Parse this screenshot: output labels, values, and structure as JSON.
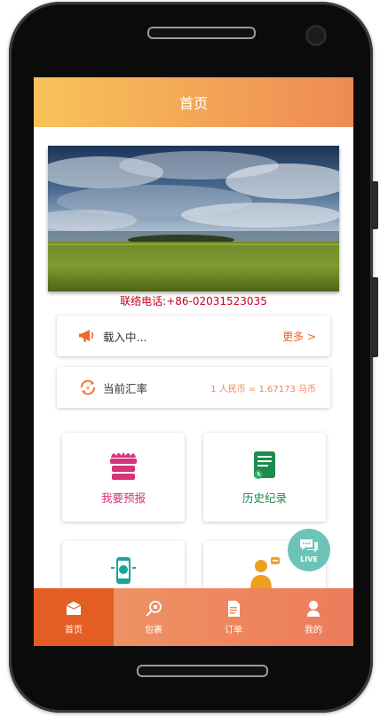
{
  "header": {
    "title": "首页"
  },
  "contact": {
    "text": "联络电话:+86-02031523035"
  },
  "notice": {
    "icon": "megaphone-icon",
    "text": "载入中...",
    "more": "更多 >"
  },
  "exchange": {
    "icon": "currency-exchange-icon",
    "label": "当前汇率",
    "value": "1 人民币 = 1.67173 马币"
  },
  "tiles": [
    {
      "label": "我要预报",
      "icon": "cake-box-icon",
      "color": "#d6337a"
    },
    {
      "label": "历史纪录",
      "icon": "history-scroll-icon",
      "color": "#1e8a4e"
    },
    {
      "label": "",
      "icon": "mobile-phone-icon",
      "color": "#1aa59b"
    },
    {
      "label": "",
      "icon": "customer-service-icon",
      "color": "#f0a020"
    }
  ],
  "live_chat": {
    "label": "LIVE",
    "icon": "chat-bubble-icon"
  },
  "tabbar": {
    "items": [
      {
        "label": "首页",
        "icon": "home-box-icon",
        "active": true
      },
      {
        "label": "包裹",
        "icon": "package-search-icon",
        "active": false
      },
      {
        "label": "订单",
        "icon": "order-document-icon",
        "active": false
      },
      {
        "label": "我的",
        "icon": "user-icon",
        "active": false
      }
    ]
  },
  "colors": {
    "accent": "#e45d23",
    "header_start": "#f8c35a",
    "header_end": "#ee8a55",
    "contact_red": "#c8001e"
  }
}
